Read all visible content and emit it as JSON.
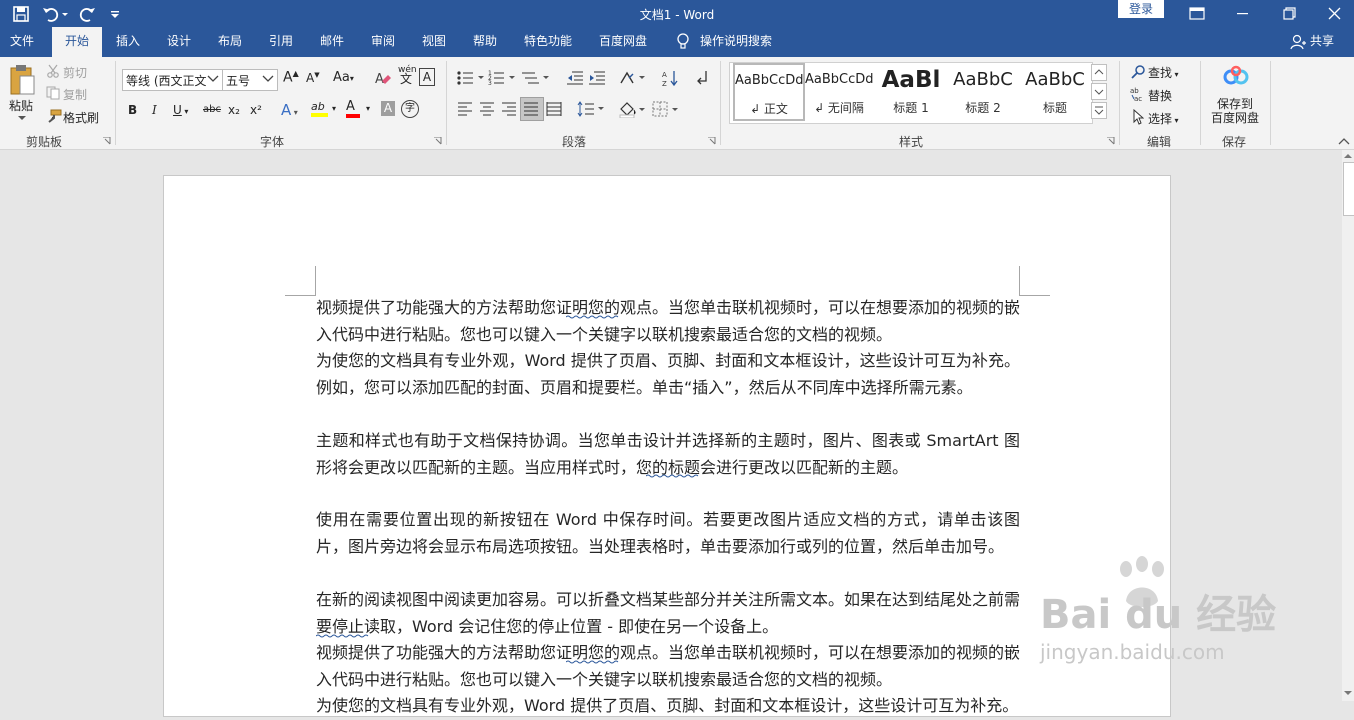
{
  "titlebar": {
    "title": "文档1  -  Word",
    "login": "登录"
  },
  "tabs": [
    "文件",
    "开始",
    "插入",
    "设计",
    "布局",
    "引用",
    "邮件",
    "审阅",
    "视图",
    "帮助",
    "特色功能",
    "百度网盘",
    "操作说明搜索"
  ],
  "share": "共享",
  "clipboard": {
    "paste": "粘贴",
    "cut": "剪切",
    "copy": "复制",
    "format_painter": "格式刷",
    "label": "剪贴板"
  },
  "font": {
    "family": "等线 (西文正文)",
    "size": "五号",
    "label": "字体",
    "bold": "B",
    "italic": "I",
    "underline": "U",
    "strike": "abc",
    "subscript": "x₂",
    "superscript": "x²",
    "grow": "A",
    "shrink": "A",
    "case": "Aa",
    "phonetic": "wén",
    "border_char": "A",
    "highlight": "ab",
    "font_color": "A",
    "shade": "A",
    "enclose": "字"
  },
  "paragraph": {
    "label": "段落"
  },
  "styles": {
    "label": "样式",
    "items": [
      {
        "sample": "AaBbCcDd",
        "name": "↲ 正文"
      },
      {
        "sample": "AaBbCcDd",
        "name": "↲ 无间隔"
      },
      {
        "sample": "AaBl",
        "name": "标题 1"
      },
      {
        "sample": "AaBbC",
        "name": "标题 2"
      },
      {
        "sample": "AaBbC",
        "name": "标题"
      }
    ]
  },
  "editing": {
    "find": "查找",
    "replace": "替换",
    "select": "选择",
    "label": "编辑"
  },
  "save": {
    "line1": "保存到",
    "line2": "百度网盘",
    "label": "保存"
  },
  "document": {
    "paragraphs": [
      "视频提供了功能强大的方法帮助您证明您的观点。当您单击联机视频时，可以在想要添加的视频的嵌入代码中进行粘贴。您也可以键入一个关键字以联机搜索最适合您的文档的视频。",
      "为使您的文档具有专业外观，Word 提供了页眉、页脚、封面和文本框设计，这些设计可互为补充。例如，您可以添加匹配的封面、页眉和提要栏。单击“插入”，然后从不同库中选择所需元素。",
      "主题和样式也有助于文档保持协调。当您单击设计并选择新的主题时，图片、图表或 SmartArt 图形将会更改以匹配新的主题。当应用样式时，您的标题会进行更改以匹配新的主题。",
      "使用在需要位置出现的新按钮在 Word 中保存时间。若要更改图片适应文档的方式，请单击该图片，图片旁边将会显示布局选项按钮。当处理表格时，单击要添加行或列的位置，然后单击加号。",
      "在新的阅读视图中阅读更加容易。可以折叠文档某些部分并关注所需文本。如果在达到结尾处之前需要停止读取，Word 会记住您的停止位置 - 即使在另一个设备上。",
      "视频提供了功能强大的方法帮助您证明您的观点。当您单击联机视频时，可以在想要添加的视频的嵌入代码中进行粘贴。您也可以键入一个关键字以联机搜索最适合您的文档的视频。",
      "为使您的文档具有专业外观，Word 提供了页眉、页脚、封面和文本框设计，这些设计可互为补充。"
    ]
  },
  "watermark": {
    "brand": "Bai du 经验",
    "url": "jingyan.baidu.com"
  }
}
